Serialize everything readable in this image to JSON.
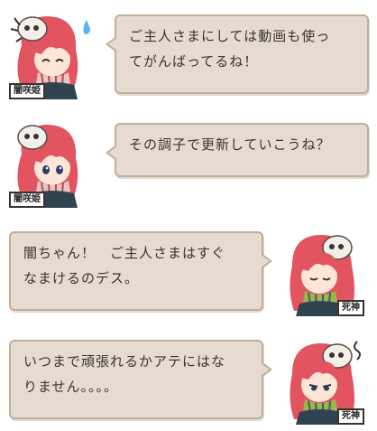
{
  "messages": [
    {
      "speaker": "闇咲姫",
      "side": "left",
      "lines": [
        "ご主人さまにしては動画も使っ",
        "てがんばってるね！"
      ],
      "expression": "happy-sweat"
    },
    {
      "speaker": "闇咲姫",
      "side": "left",
      "lines": [
        "その調子で更新していこうね？"
      ],
      "expression": "neutral"
    },
    {
      "speaker": "死神",
      "side": "right",
      "lines": [
        "闇ちゃん！　ご主人さまはすぐ",
        "なまけるのデス。"
      ],
      "expression": "eyes-closed"
    },
    {
      "speaker": "死神",
      "side": "right",
      "lines": [
        "いつまで頑張れるかアテにはな",
        "りません。。。。"
      ],
      "expression": "annoyed"
    }
  ],
  "colors": {
    "bubble_fill": "#e5dbd0",
    "bubble_border": "#c1ad98",
    "hair": "#e2545f",
    "skull": "#f3f0ea"
  }
}
